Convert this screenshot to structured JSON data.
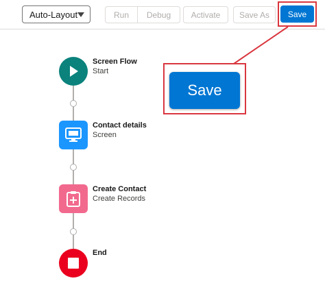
{
  "toolbar": {
    "layout_select": "Auto-Layout",
    "run_label": "Run",
    "debug_label": "Debug",
    "activate_label": "Activate",
    "save_as_label": "Save As",
    "save_label": "Save"
  },
  "callout": {
    "save_label": "Save"
  },
  "flow": {
    "nodes": [
      {
        "title": "Screen Flow",
        "subtitle": "Start",
        "icon": "play-icon",
        "color": "#0b827c"
      },
      {
        "title": "Contact details",
        "subtitle": "Screen",
        "icon": "screen-icon",
        "color": "#1b96ff"
      },
      {
        "title": "Create Contact",
        "subtitle": "Create Records",
        "icon": "create-record-icon",
        "color": "#f2698e"
      },
      {
        "title": "End",
        "subtitle": "",
        "icon": "stop-icon",
        "color": "#ea001e"
      }
    ]
  },
  "colors": {
    "accent": "#0176d3",
    "highlight": "#d9363e"
  }
}
